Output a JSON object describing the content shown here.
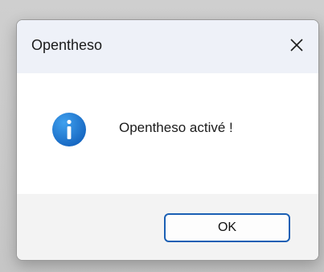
{
  "dialog": {
    "title": "Opentheso",
    "close_icon": "close-icon",
    "message_icon": "info-icon",
    "message": "Opentheso activé !",
    "ok_label": "OK"
  },
  "colors": {
    "accent": "#1a5fb4",
    "info_icon": "#1f7fd6",
    "titlebar": "#eef1f8",
    "footer": "#f3f3f3"
  }
}
